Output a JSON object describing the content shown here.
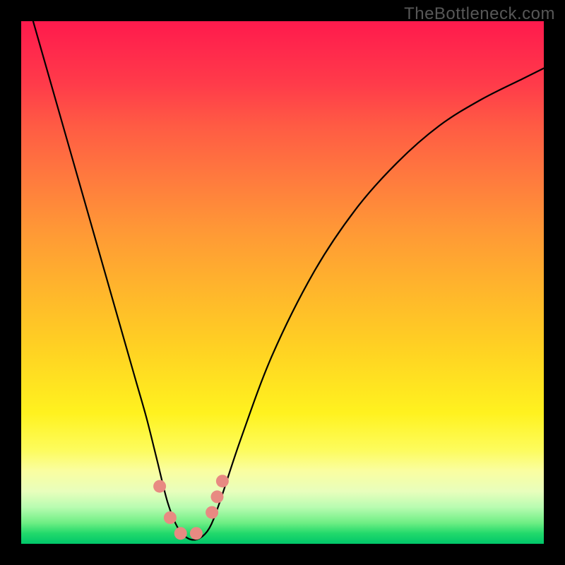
{
  "watermark": "TheBottleneck.com",
  "chart_data": {
    "type": "line",
    "title": "",
    "xlabel": "",
    "ylabel": "",
    "xlim": [
      0,
      100
    ],
    "ylim": [
      0,
      100
    ],
    "series": [
      {
        "name": "curve",
        "x": [
          0,
          4,
          8,
          12,
          16,
          20,
          22,
          24,
          26,
          28,
          30,
          32,
          34,
          36,
          38,
          42,
          48,
          56,
          64,
          72,
          80,
          88,
          96,
          100
        ],
        "values": [
          108,
          94,
          80,
          66,
          52,
          38,
          31,
          24,
          16,
          8,
          3,
          1,
          1,
          3,
          8,
          20,
          36,
          52,
          64,
          73,
          80,
          85,
          89,
          91
        ]
      }
    ],
    "markers": {
      "name": "highlight-dots",
      "color": "#e88a82",
      "points": [
        {
          "x": 26.5,
          "y": 11
        },
        {
          "x": 28.5,
          "y": 5
        },
        {
          "x": 30.5,
          "y": 2
        },
        {
          "x": 33.5,
          "y": 2
        },
        {
          "x": 36.5,
          "y": 6
        },
        {
          "x": 37.5,
          "y": 9
        },
        {
          "x": 38.5,
          "y": 12
        }
      ]
    },
    "gradient_stops": [
      {
        "pos": 0,
        "color": "#ff1a4d"
      },
      {
        "pos": 50,
        "color": "#ffb22d"
      },
      {
        "pos": 80,
        "color": "#fdfc5c"
      },
      {
        "pos": 100,
        "color": "#00c66a"
      }
    ]
  }
}
